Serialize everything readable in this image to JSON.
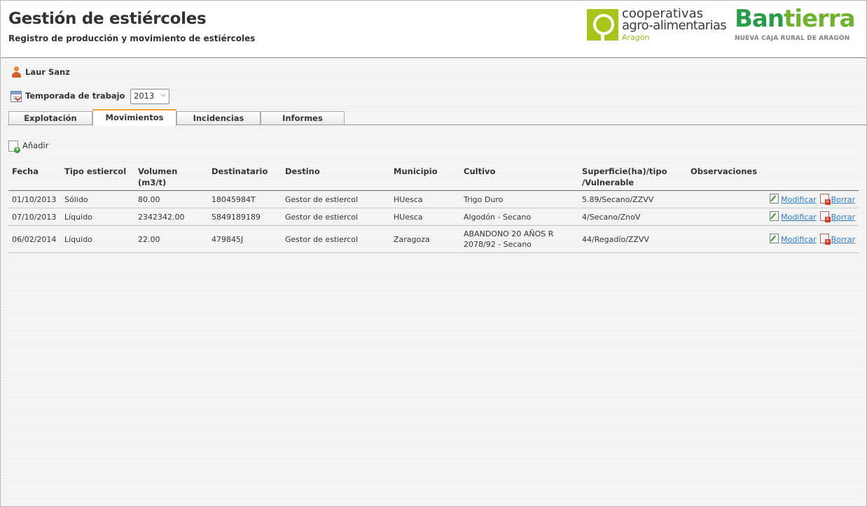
{
  "header": {
    "title": "Gestión de estiércoles",
    "subtitle": "Registro de producción y movimiento de estiércoles",
    "coop_logo": {
      "line1": "cooperativas",
      "line2": "agro-alimentarias",
      "line3": "Aragón"
    },
    "bank_logo": {
      "name_a": "Ban",
      "name_b": "tierra",
      "tagline": "NUEVA CAJA RURAL DE ARAGÓN"
    }
  },
  "user": {
    "name": "Laur Sanz",
    "icon": "user-icon"
  },
  "season": {
    "label": "Temporada de trabajo",
    "selected": "2013",
    "icon": "calendar-icon"
  },
  "tabs": [
    {
      "label": "Explotación",
      "active": false
    },
    {
      "label": "Movimientos",
      "active": true
    },
    {
      "label": "Incidencias",
      "active": false
    },
    {
      "label": "Informes",
      "active": false
    }
  ],
  "toolbar": {
    "add_label": "Añadir",
    "add_icon": "add-document-icon"
  },
  "table": {
    "headers": [
      "Fecha",
      "Tipo estiercol",
      "Volumen (m3/t)",
      "Destinatario",
      "Destino",
      "Municipio",
      "Cultivo",
      "Superficie(ha)/tipo /Vulnerable",
      "Observaciones",
      ""
    ],
    "rows": [
      {
        "fecha": "01/10/2013",
        "tipo": "Sólido",
        "volumen": "80.00",
        "destinatario": "18045984T",
        "destino": "Gestor de estiercol",
        "municipio": "HUesca",
        "cultivo": "Trigo Duro",
        "superficie": "5.89/Secano/ZZVV",
        "observaciones": ""
      },
      {
        "fecha": "07/10/2013",
        "tipo": "Líquido",
        "volumen": "2342342.00",
        "destinatario": "5849189189",
        "destino": "Gestor de estiercol",
        "municipio": "HUesca",
        "cultivo": "Algodón - Secano",
        "superficie": "4/Secano/ZnoV",
        "observaciones": ""
      },
      {
        "fecha": "06/02/2014",
        "tipo": "Líquido",
        "volumen": "22.00",
        "destinatario": "479845J",
        "destino": "Gestor de estiercol",
        "municipio": "Zaragoza",
        "cultivo": "ABANDONO 20 AÑOS R 2078/92 - Secano",
        "superficie": "44/Regadío/ZZVV",
        "observaciones": ""
      }
    ],
    "actions": {
      "edit_label": "Modificar",
      "delete_label": "Borrar",
      "edit_icon": "edit-icon",
      "delete_icon": "delete-icon"
    }
  },
  "colors": {
    "tab_active_accent": "#f0a030",
    "link": "#2e7bc4",
    "bank_green": "#2a9b48",
    "coop_green": "#a8c31a"
  }
}
